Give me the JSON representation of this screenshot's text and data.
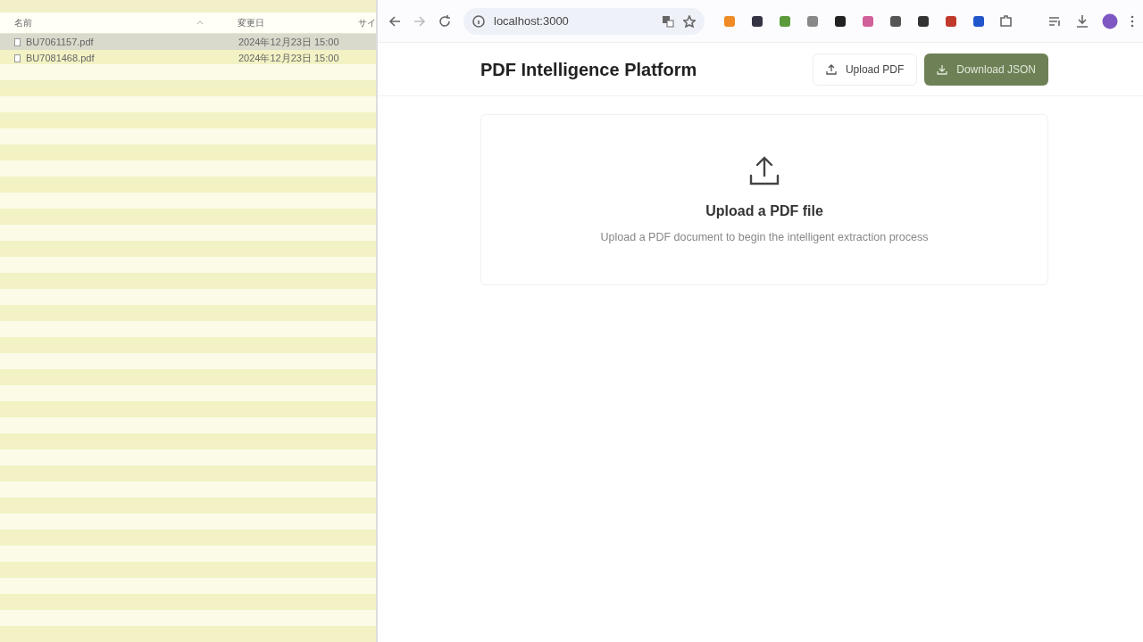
{
  "file_window": {
    "columns": [
      {
        "label": "名前",
        "sorted": true
      },
      {
        "label": "変更日",
        "sorted": false
      },
      {
        "label": "サイ",
        "sorted": false
      }
    ],
    "rows": [
      {
        "name": "BU7061157.pdf",
        "modified": "2024年12月23日 15:00",
        "selected": true
      },
      {
        "name": "BU7081468.pdf",
        "modified": "2024年12月23日 15:00",
        "selected": false
      }
    ]
  },
  "browser": {
    "address": "localhost:3000",
    "extensions": [
      {
        "color": "#f08a24"
      },
      {
        "color": "#333344"
      },
      {
        "color": "#5a9a3a"
      },
      {
        "color": "#888888"
      },
      {
        "color": "#222222"
      },
      {
        "color": "#d0609a"
      },
      {
        "color": "#555555"
      },
      {
        "color": "#333333"
      },
      {
        "color": "#c0392b"
      },
      {
        "color": "#2255cc"
      }
    ]
  },
  "app": {
    "title": "PDF Intelligence Platform",
    "buttons": [
      {
        "label": "Upload PDF",
        "kind": "outline"
      },
      {
        "label": "Download JSON",
        "kind": "primary"
      }
    ],
    "dropzone": {
      "title": "Upload a PDF file",
      "subtitle": "Upload a PDF document to begin the intelligent extraction process"
    }
  }
}
